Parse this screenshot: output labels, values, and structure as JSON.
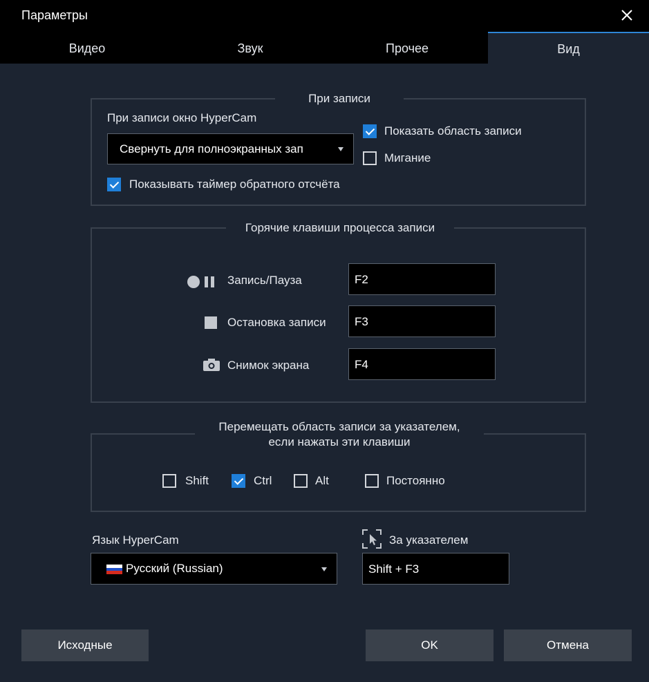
{
  "window": {
    "title": "Параметры",
    "close_icon": "close-icon"
  },
  "tabs": [
    {
      "label": "Видео",
      "active": false
    },
    {
      "label": "Звук",
      "active": false
    },
    {
      "label": "Прочее",
      "active": false
    },
    {
      "label": "Вид",
      "active": true
    }
  ],
  "recording": {
    "legend": "При записи",
    "window_label": "При записи окно HyperCam",
    "window_mode_value": "Свернуть для полноэкранных зап",
    "show_area_label": "Показать область записи",
    "show_area_checked": true,
    "blink_label": "Мигание",
    "blink_checked": false,
    "countdown_label": "Показывать таймер обратного отсчёта",
    "countdown_checked": true
  },
  "hotkeys": {
    "legend": "Горячие клавиши процесса записи",
    "items": [
      {
        "icon": "record-pause-icon",
        "label": "Запись/Пауза",
        "value": "F2"
      },
      {
        "icon": "stop-icon",
        "label": "Остановка записи",
        "value": "F3"
      },
      {
        "icon": "camera-icon",
        "label": "Снимок экрана",
        "value": "F4"
      }
    ]
  },
  "follow": {
    "legend_line1": "Перемещать область записи за указателем,",
    "legend_line2": "если нажаты эти клавиши",
    "options": [
      {
        "label": "Shift",
        "checked": false
      },
      {
        "label": "Ctrl",
        "checked": true
      },
      {
        "label": "Alt",
        "checked": false
      },
      {
        "label": "Постоянно",
        "checked": false
      }
    ]
  },
  "language": {
    "label": "Язык HyperCam",
    "value": "Русский (Russian)",
    "flag_icon": "russian-flag-icon"
  },
  "follow_pointer": {
    "label": "За указателем",
    "icon": "cursor-target-icon",
    "value": "Shift + F3"
  },
  "buttons": {
    "defaults": "Исходные",
    "ok": "OK",
    "cancel": "Отмена"
  },
  "colors": {
    "background": "#1c2431",
    "titlebar": "#000000",
    "accent": "#1f7fd9",
    "button": "#3a414b",
    "border": "#39414d"
  }
}
